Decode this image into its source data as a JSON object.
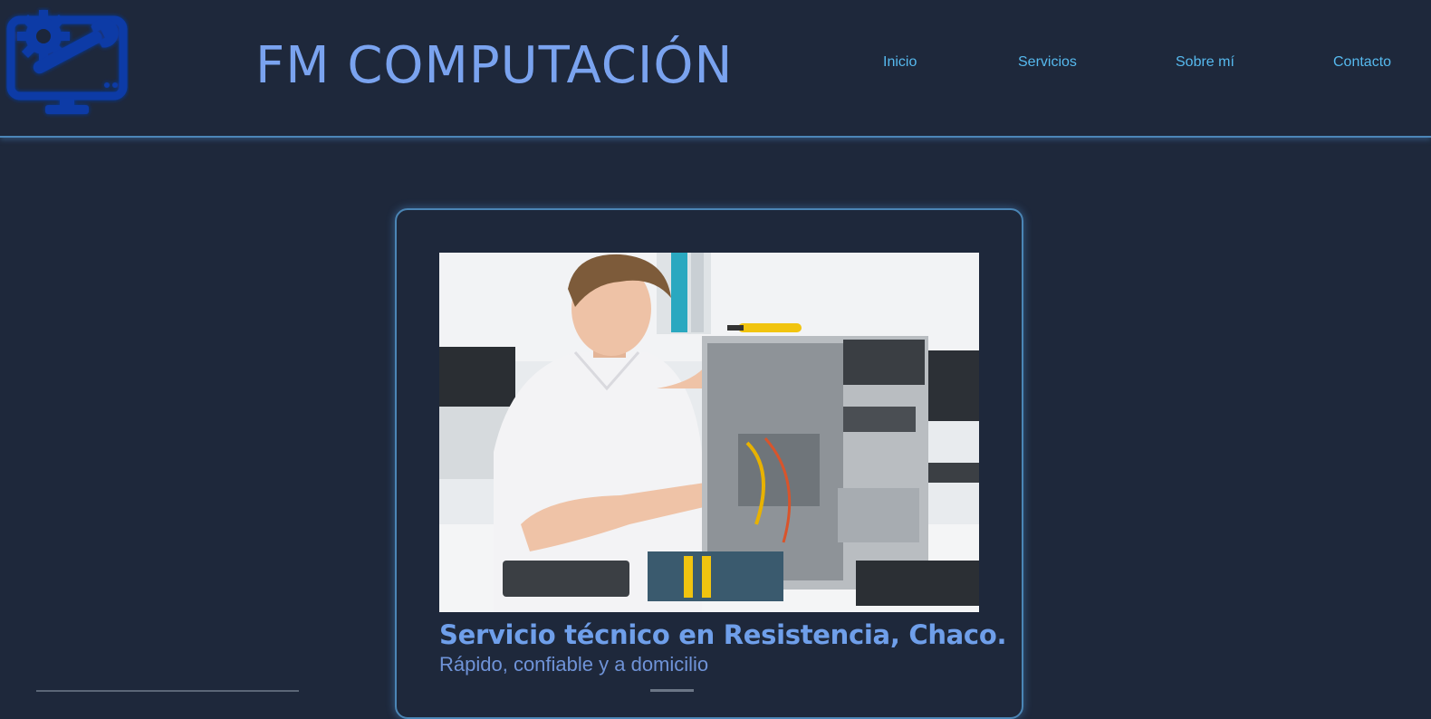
{
  "brand": {
    "title": "FM COMPUTACIÓN",
    "logo_icon": "monitor-gear-wrench-icon",
    "color": "#7aa3ef"
  },
  "nav": {
    "items": [
      {
        "label": "Inicio"
      },
      {
        "label": "Servicios"
      },
      {
        "label": "Sobre mí"
      },
      {
        "label": "Contacto"
      }
    ],
    "color": "#56b9ee"
  },
  "hero": {
    "title": "Servicio técnico en Resistencia, Chaco.",
    "subtitle": "Rápido, confiable y a domicilio",
    "image_alt": "Técnico reparando una computadora"
  },
  "theme": {
    "background": "#1e283b",
    "accent_border": "#4b86b6"
  }
}
